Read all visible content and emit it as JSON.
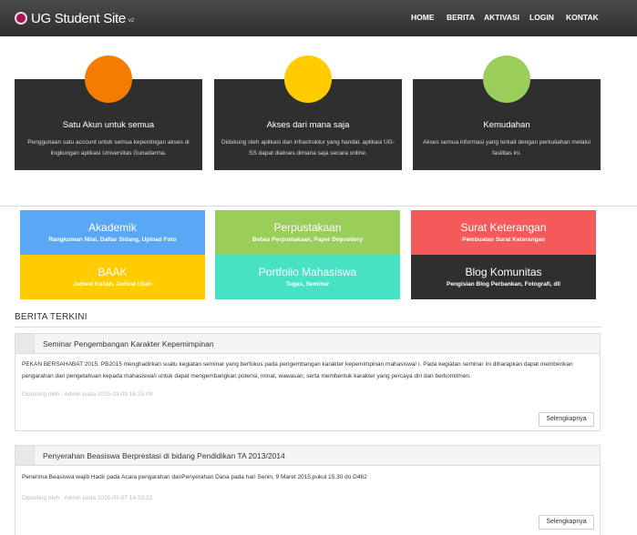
{
  "nav": {
    "brand": "UG Student Site",
    "version": "v2",
    "items": [
      {
        "label": "HOME"
      },
      {
        "label": "BERITA"
      },
      {
        "label": "AKTIVASI"
      },
      {
        "label": "LOGIN"
      },
      {
        "label": "KONTAK"
      }
    ]
  },
  "features": [
    {
      "title": "Satu Akun untuk semua",
      "desc": "Penggunaan satu account untuk semua kepentingan akses di lingkungan aplikasi Universitas Gunadarma.",
      "color": "#f57c00"
    },
    {
      "title": "Akses dari mana saja",
      "desc": "Didukung oleh aplikasi dan infrastruktur yang handal, aplikasi UG-SS dapat diakses dimana saja secara online.",
      "color": "#ffcc00"
    },
    {
      "title": "Kemudahan",
      "desc": "Akses semua informasi yang terkait dengan perkuliahan melalui fasilitas ini.",
      "color": "#9acd5a"
    }
  ],
  "tiles": [
    {
      "title": "Akademik",
      "sub": "Rangkuman Nilai, Daftar Sidang, Upload Foto",
      "color": "#5aa8f5"
    },
    {
      "title": "Perpustakaan",
      "sub": "Bebas Perpustakaan, Paper Depository",
      "color": "#9acd5a"
    },
    {
      "title": "Surat Keterangan",
      "sub": "Pembuatan Surat Keterangan",
      "color": "#f45a5a"
    },
    {
      "title": "BAAK",
      "sub": "Jadwal Kuliah, Jadwal Ujian",
      "color": "#ffcc00"
    },
    {
      "title": "Portfolio Mahasiswa",
      "sub": "Tugas, Seminar",
      "color": "#47e1c3"
    },
    {
      "title": "Blog Komunitas",
      "sub": "Pengisian Blog Perbankan, Fotografi, dll",
      "color": "#2f2f2f"
    }
  ],
  "news": {
    "heading": "BERITA TERKINI",
    "more_label": "Selengkapnya",
    "posts": [
      {
        "title": "Seminar Pengembangan Karakter Kepemimpinan",
        "body": "PEKAN BERSAHABAT 2015. PB2015 menghadirkan suatu kegiatan seminar yang berfokus pada pengembangan karakter kepemimpinan mahasiswa/ i. Pada kegiatan seminar ini diharapkan dapat memberikan pengarahan dan pengetahuan kepada mahasiswa/i untuk dapat mengembangkan potensi, minat, wawasan, serta membentuk karakter yang percaya diri dan berkomitmen.",
        "meta": "Diposting oleh : Admin pada 2015-03-09 16:25:09"
      },
      {
        "title": "Penyerahan Beasiswa Berprestasi di bidang Pendidikan TA 2013/2014",
        "body": "Penerima Beasiswa wajib Hadir pada Acara pengarahan danPenyerahan Dana pada hari Senin, 9 Maret 2015,pukul 15.30 do D462",
        "meta": "Diposting oleh : Admin pada 2015-03-07 14:23:22"
      }
    ]
  }
}
